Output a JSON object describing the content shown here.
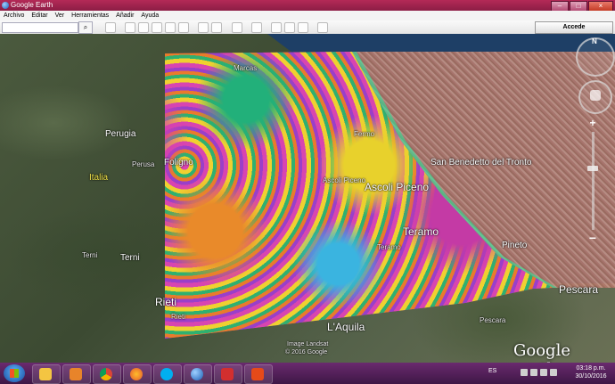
{
  "window": {
    "title": "Google Earth"
  },
  "menu": {
    "items": [
      "Archivo",
      "Editar",
      "Ver",
      "Herramientas",
      "Añadir",
      "Ayuda"
    ]
  },
  "toolbar": {
    "accede_label": "Accede"
  },
  "map": {
    "labels": {
      "marcas": "Marcas",
      "perugia": "Perugia",
      "perusa": "Perusa",
      "italia": "Italia",
      "foligno": "Foligno",
      "fermo": "Fermo",
      "san_benedetto": "San Benedetto del Tronto",
      "ascoli_piceno": "Ascoli Piceno",
      "ascoli_piceno_small": "Ascoli Piceno",
      "teramo": "Teramo",
      "teramo_small": "Teramo",
      "pineto": "Pineto",
      "terni": "Terni",
      "terni_small": "Terni",
      "rieti": "Rieti",
      "rieti_small": "Rieti",
      "laquila": "L'Aquila",
      "pescara": "Pescara",
      "pescara_small": "Pescara"
    },
    "attribution": [
      "Image Landsat",
      "© 2016 Google"
    ],
    "logo": "Google earth"
  },
  "taskbar": {
    "apps": [
      "file-explorer",
      "media-player",
      "chrome",
      "firefox",
      "skype",
      "google-earth",
      "acrobat",
      "screen-recorder"
    ],
    "language": "ES",
    "time": "03:18 p.m.",
    "date": "30/10/2016"
  }
}
